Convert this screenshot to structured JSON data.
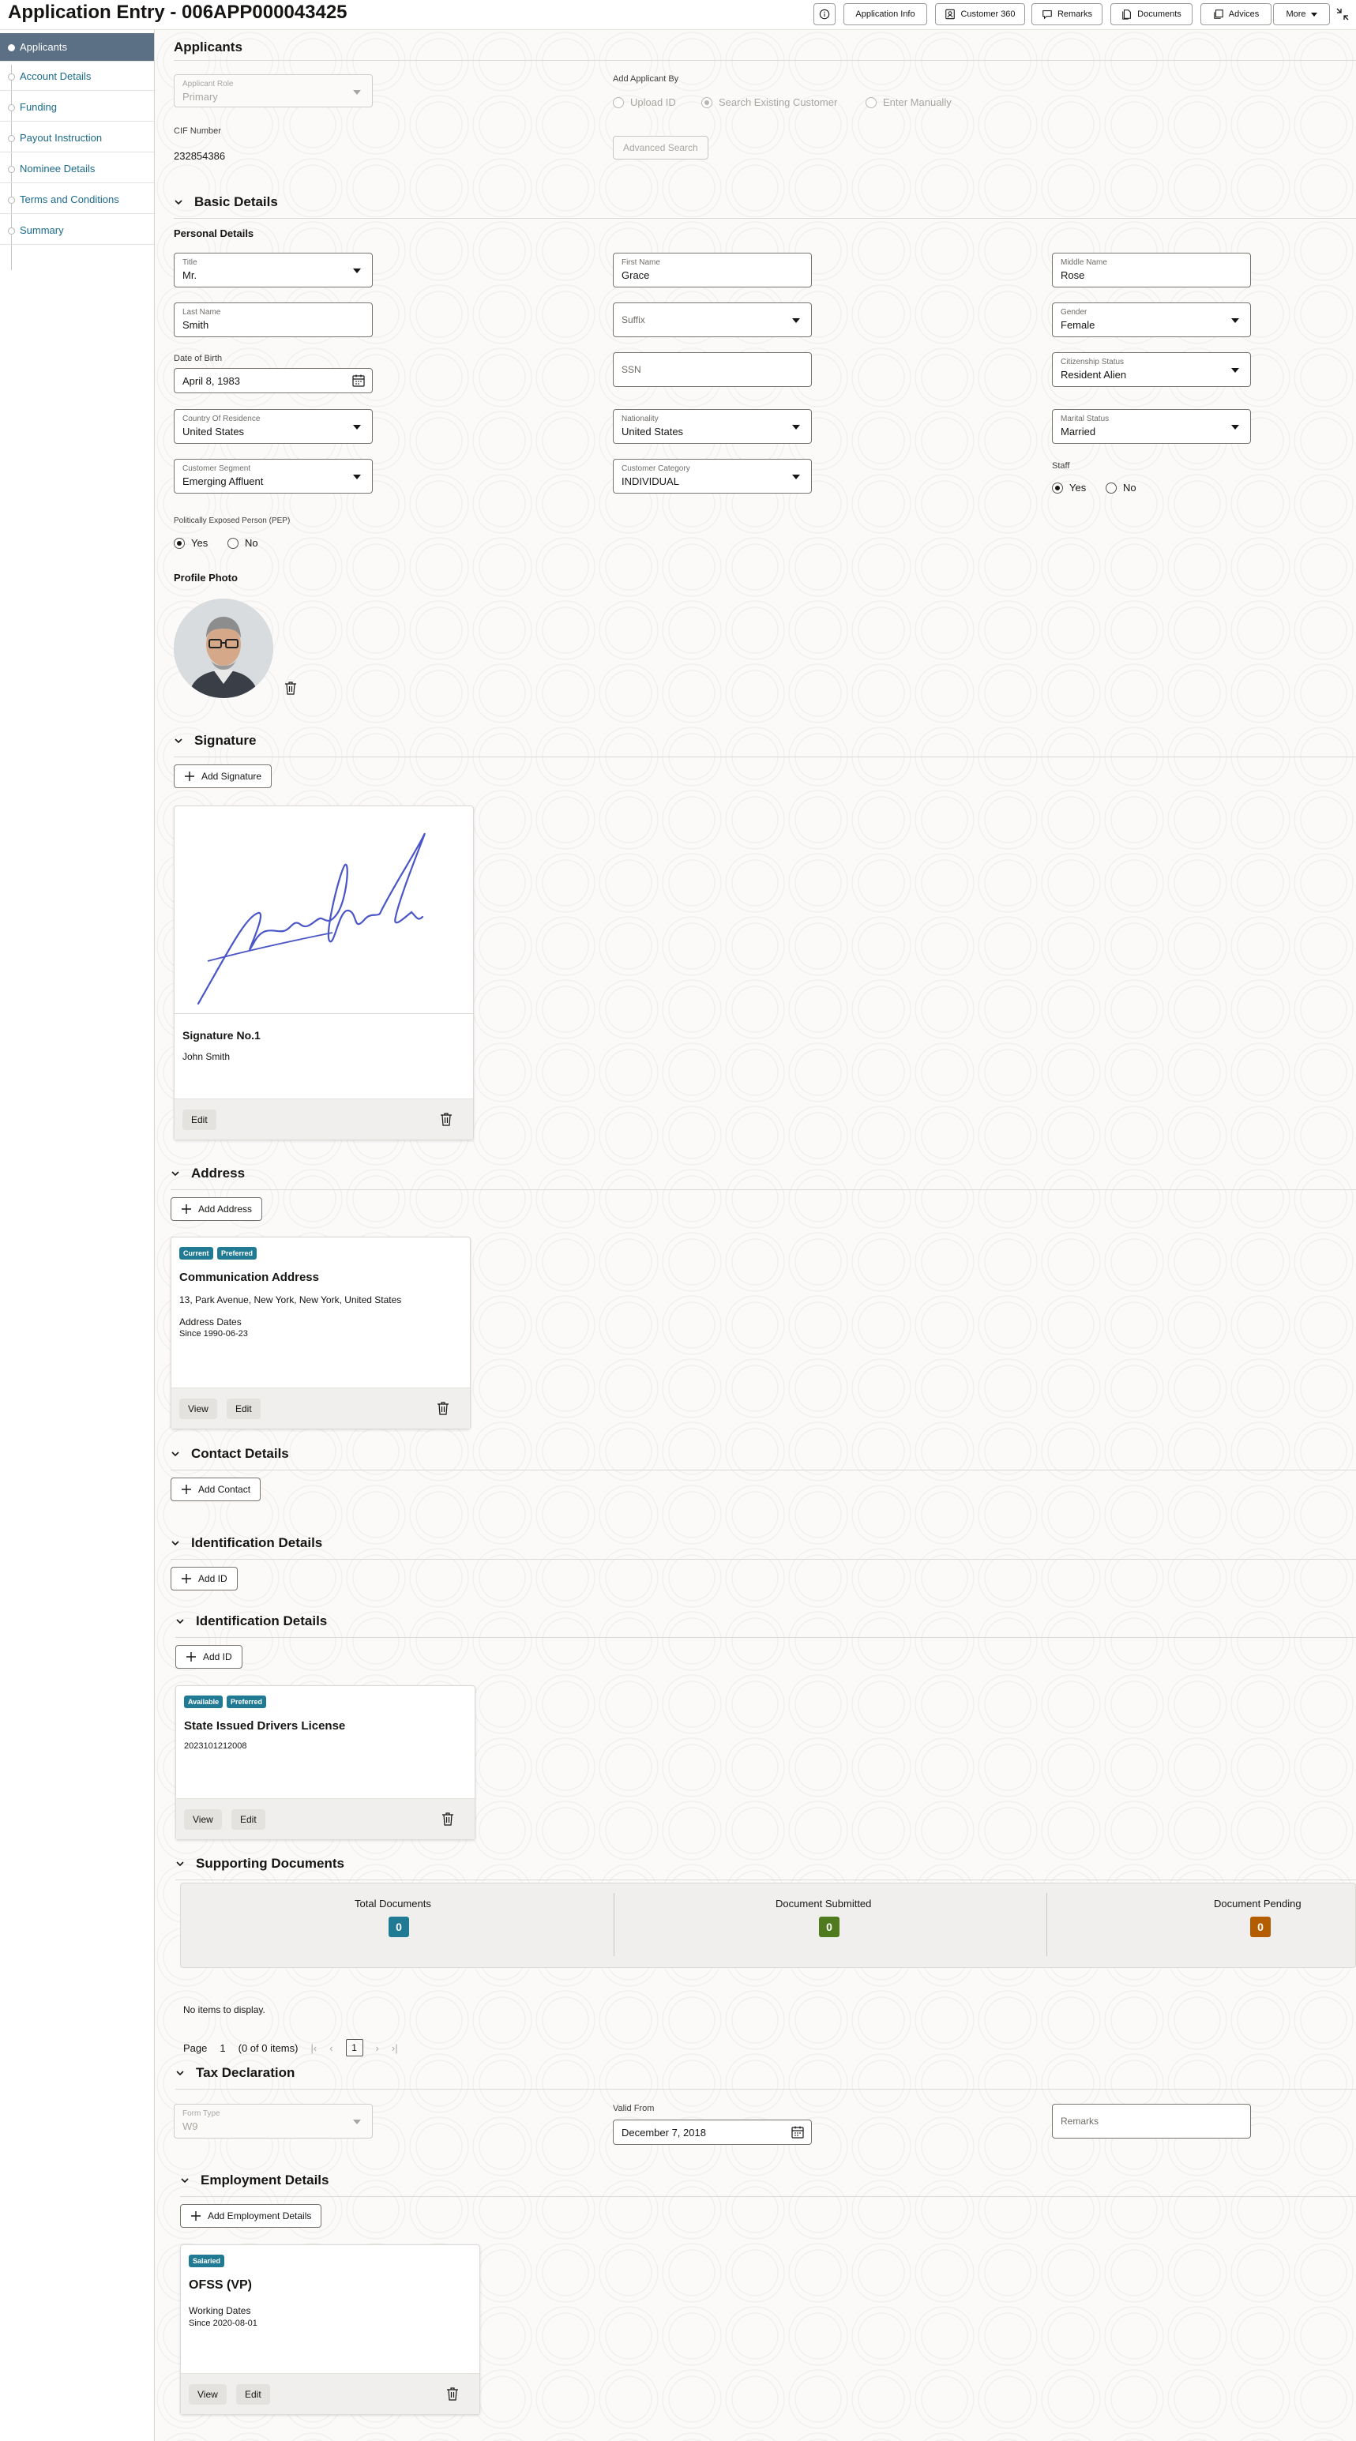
{
  "header": {
    "title": "Application Entry - 006APP000043425",
    "buttons": {
      "app_info": "Application Info",
      "customer360": "Customer 360",
      "remarks": "Remarks",
      "documents": "Documents",
      "advices": "Advices",
      "more": "More"
    }
  },
  "sidebar": {
    "items": [
      "Applicants",
      "Account Details",
      "Funding",
      "Payout Instruction",
      "Nominee Details",
      "Terms and Conditions",
      "Summary"
    ]
  },
  "applicants": {
    "title": "Applicants",
    "role_label": "Applicant Role",
    "role_value": "Primary",
    "add_by_label": "Add Applicant By",
    "add_by_options": [
      "Upload ID",
      "Search Existing Customer",
      "Enter Manually"
    ],
    "cif_label": "CIF Number",
    "cif_value": "232854386",
    "advanced_search": "Advanced Search"
  },
  "basic": {
    "title": "Basic Details",
    "personal_title": "Personal Details",
    "title_label": "Title",
    "title_value": "Mr.",
    "first_label": "First Name",
    "first_value": "Grace",
    "middle_label": "Middle Name",
    "middle_value": "Rose",
    "last_label": "Last Name",
    "last_value": "Smith",
    "suffix_ph": "Suffix",
    "gender_label": "Gender",
    "gender_value": "Female",
    "dob_label": "Date of Birth",
    "dob_value": "April 8, 1983",
    "ssn_ph": "SSN",
    "citizen_label": "Citizenship Status",
    "citizen_value": "Resident Alien",
    "country_label": "Country Of Residence",
    "country_value": "United States",
    "nationality_label": "Nationality",
    "nationality_value": "United States",
    "marital_label": "Marital Status",
    "marital_value": "Married",
    "segment_label": "Customer Segment",
    "segment_value": "Emerging Affluent",
    "category_label": "Customer Category",
    "category_value": "INDIVIDUAL",
    "staff_label": "Staff",
    "yes": "Yes",
    "no": "No",
    "pep_label": "Politically Exposed Person (PEP)",
    "photo_label": "Profile Photo"
  },
  "signature": {
    "title": "Signature",
    "add": "Add Signature",
    "card_title": "Signature No.1",
    "card_name": "John Smith",
    "edit": "Edit"
  },
  "address": {
    "title": "Address",
    "add": "Add Address",
    "badge1": "Current",
    "badge2": "Preferred",
    "card_title": "Communication Address",
    "line": "13, Park Avenue, New York, New York, United States",
    "dates_label": "Address Dates",
    "since": "Since 1990-06-23",
    "view": "View",
    "edit": "Edit"
  },
  "contact": {
    "title": "Contact Details",
    "add": "Add Contact"
  },
  "identification": {
    "title": "Identification Details",
    "add": "Add ID",
    "badge1": "Available",
    "badge2": "Preferred",
    "card_title": "State Issued Drivers License",
    "card_number": "2023101212008",
    "view": "View",
    "edit": "Edit"
  },
  "supporting": {
    "title": "Supporting Documents",
    "total_label": "Total Documents",
    "total": "0",
    "submitted_label": "Document Submitted",
    "submitted": "0",
    "pending_label": "Document Pending",
    "pending": "0",
    "empty": "No items to display.",
    "page_label": "Page",
    "page_num": "1",
    "page_info": "(0 of 0 items)",
    "page_box": "1"
  },
  "tax": {
    "title": "Tax Declaration",
    "form_label": "Form Type",
    "form_value": "W9",
    "valid_label": "Valid From",
    "valid_value": "December 7, 2018",
    "remarks_ph": "Remarks"
  },
  "employment": {
    "title": "Employment Details",
    "add": "Add Employment Details",
    "badge": "Salaried",
    "card_title": "OFSS (VP)",
    "dates_label": "Working Dates",
    "since": "Since 2020-08-01",
    "view": "View",
    "edit": "Edit"
  },
  "colors": {
    "sidebar_active": "#5b6f85",
    "link": "#1b6a8a",
    "badge_teal": "#217a94",
    "badge_green": "#507a1e",
    "badge_orange": "#b35c00"
  }
}
